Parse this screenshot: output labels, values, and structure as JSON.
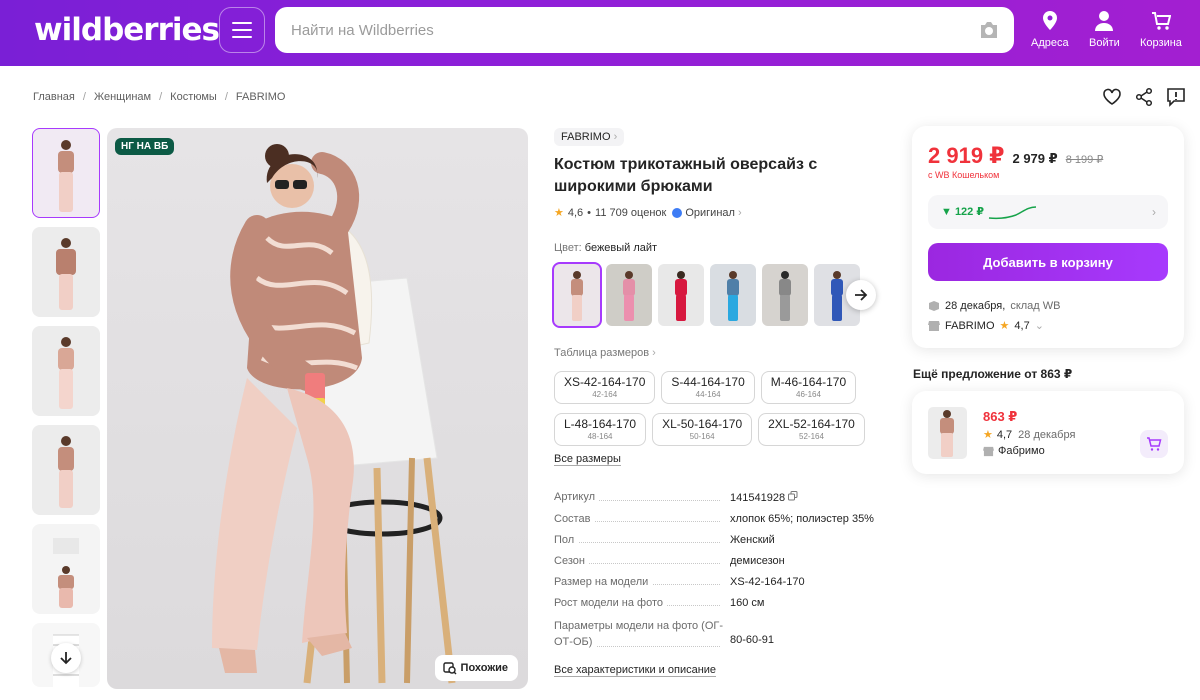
{
  "header": {
    "logo": "wildberries",
    "search_placeholder": "Найти на Wildberries",
    "nav": [
      {
        "label": "Адреса",
        "icon": "location-pin-icon"
      },
      {
        "label": "Войти",
        "icon": "user-icon"
      },
      {
        "label": "Корзина",
        "icon": "cart-icon"
      }
    ]
  },
  "breadcrumbs": [
    "Главная",
    "Женщинам",
    "Костюмы",
    "FABRIMO"
  ],
  "gallery": {
    "badge": "НГ НА ВБ",
    "similar_label": "Похожие"
  },
  "product": {
    "brand": "FABRIMO",
    "title": "Костюм трикотажный оверсайз с широкими брюками",
    "rating": "4,6",
    "reviews": "11 709 оценок",
    "original_label": "Оригинал",
    "color_label": "Цвет:",
    "color_value": "бежевый лайт",
    "size_table_label": "Таблица размеров",
    "sizes": [
      {
        "name": "XS-42-164-170",
        "sub": "42-164"
      },
      {
        "name": "S-44-164-170",
        "sub": "44-164"
      },
      {
        "name": "M-46-164-170",
        "sub": "46-164"
      },
      {
        "name": "L-48-164-170",
        "sub": "48-164"
      },
      {
        "name": "XL-50-164-170",
        "sub": "50-164"
      },
      {
        "name": "2XL-52-164-170",
        "sub": "52-164"
      }
    ],
    "all_sizes_label": "Все размеры",
    "specs": [
      {
        "key": "Артикул",
        "value": "141541928"
      },
      {
        "key": "Состав",
        "value": "хлопок 65%; полиэстер 35%"
      },
      {
        "key": "Пол",
        "value": "Женский"
      },
      {
        "key": "Сезон",
        "value": "демисезон"
      },
      {
        "key": "Размер на модели",
        "value": "XS-42-164-170"
      },
      {
        "key": "Рост модели на фото",
        "value": "160 см"
      },
      {
        "key": "Параметры модели на фото (ОГ-ОТ-ОБ)",
        "value": "80-60-91"
      }
    ],
    "all_specs_label": "Все характеристики и описание"
  },
  "buy": {
    "price": "2 919 ₽",
    "price_regular": "2 979 ₽",
    "price_old": "8 199 ₽",
    "wallet_note": "с WB Кошельком",
    "price_delta": "▼ 122 ₽",
    "add_to_cart": "Добавить в корзину",
    "delivery_date": "28 декабря,",
    "delivery_place": "склад WB",
    "seller": "FABRIMO",
    "seller_rating": "4,7"
  },
  "other_offer": {
    "title": "Ещё предложение от 863 ₽",
    "price": "863 ₽",
    "rating": "4,7",
    "date": "28 декабря",
    "seller": "Фабримо"
  },
  "colors": {
    "brand_purple": "#a73afd",
    "price_red": "#f0323b",
    "green": "#16a34a"
  }
}
